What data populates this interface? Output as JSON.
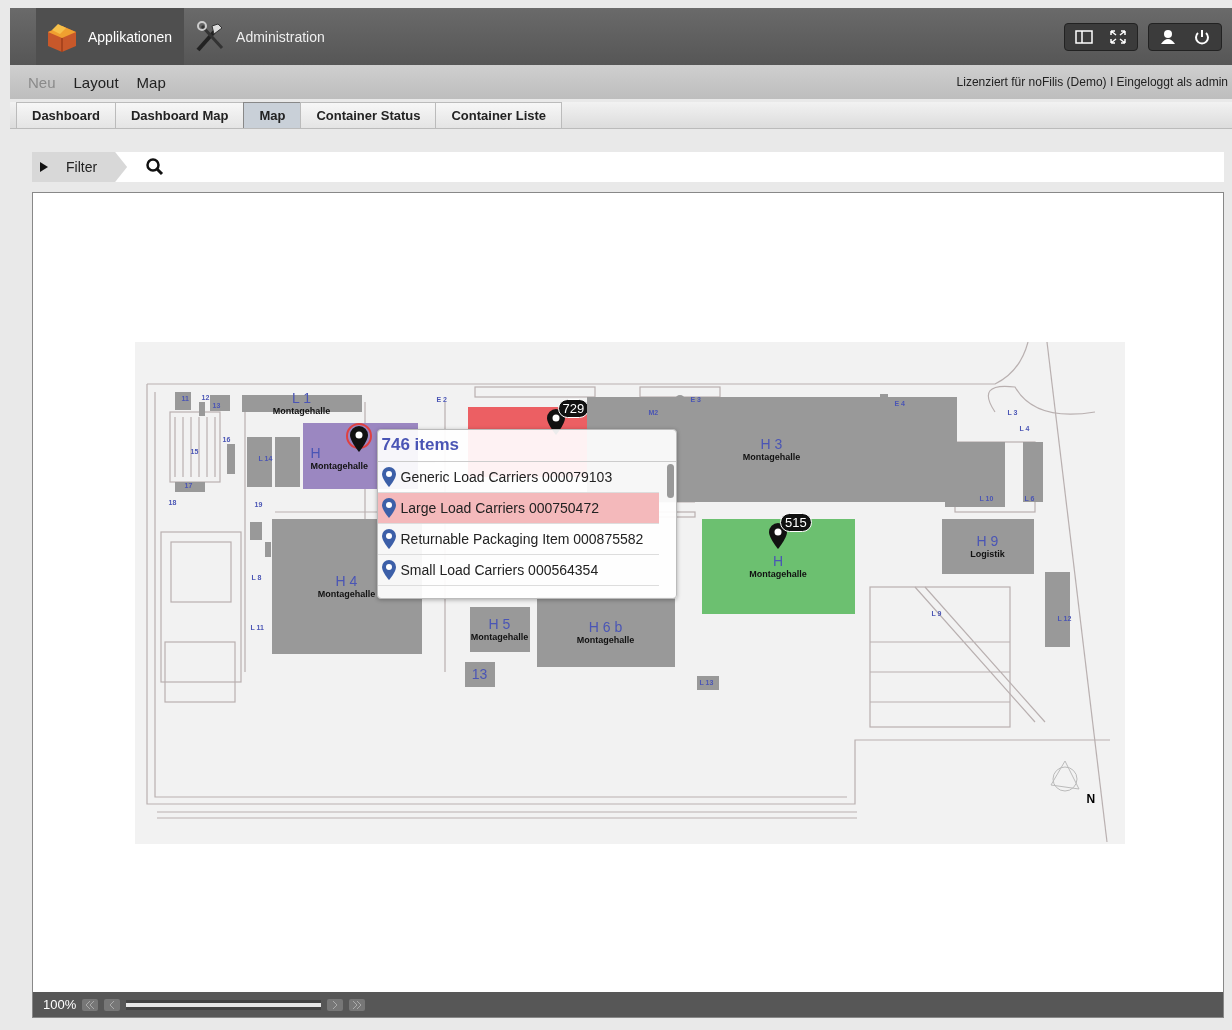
{
  "top_bar": {
    "apps": [
      {
        "label": "Applikationen",
        "selected": true
      },
      {
        "label": "Administration",
        "selected": false
      }
    ]
  },
  "menu": {
    "items": [
      {
        "label": "Neu",
        "disabled": true
      },
      {
        "label": "Layout",
        "disabled": false
      },
      {
        "label": "Map",
        "disabled": false
      }
    ],
    "status": "Lizenziert für noFilis (Demo) I Eingeloggt als admin"
  },
  "tabs": [
    {
      "label": "Dashboard",
      "selected": false
    },
    {
      "label": "Dashboard Map",
      "selected": false
    },
    {
      "label": "Map",
      "selected": true
    },
    {
      "label": "Container Status",
      "selected": false
    },
    {
      "label": "Container Liste",
      "selected": false
    }
  ],
  "filter": {
    "label": "Filter",
    "expanded": false
  },
  "map": {
    "areas": [
      {
        "kind": "building",
        "code": "L 1",
        "name": "Montagehalle"
      },
      {
        "kind": "zone",
        "color": "#9b87c1",
        "code": "H",
        "name": "Montagehalle",
        "pin": {
          "ring": true
        }
      },
      {
        "kind": "zone",
        "color": "#ec5f63",
        "pin": {
          "count": "729"
        }
      },
      {
        "kind": "building",
        "code": "H 3",
        "name": "Montagehalle"
      },
      {
        "kind": "building",
        "code": "H 4",
        "name": "Montagehalle"
      },
      {
        "kind": "building",
        "code": "H 5",
        "name": "Montagehalle"
      },
      {
        "kind": "building",
        "code": "H 6 b",
        "name": "Montagehalle"
      },
      {
        "kind": "zone",
        "color": "#6cc070",
        "code": "H",
        "name": "Montagehalle",
        "pin": {
          "count": "515"
        }
      },
      {
        "kind": "building",
        "code": "H 9",
        "name": "Logistik"
      },
      {
        "kind": "building",
        "code": "13"
      }
    ],
    "labels": [
      "11",
      "12",
      "13",
      "E 2",
      "M2",
      "E 3",
      "E 4",
      "L 3",
      "L 4",
      "L 10",
      "L 6",
      "L 9",
      "L 12",
      "L 14",
      "15",
      "16",
      "17",
      "18",
      "19",
      "L 8",
      "L 11",
      "L 13"
    ],
    "compass": "N",
    "popup": {
      "title": "746 items",
      "items": [
        {
          "label": "Generic Load Carriers 000079103",
          "selected": false
        },
        {
          "label": "Large Load Carriers 000750472",
          "selected": true
        },
        {
          "label": "Returnable Packaging Item 000875582",
          "selected": false
        },
        {
          "label": "Small Load Carriers 000564354",
          "selected": false
        }
      ]
    }
  },
  "zoom": {
    "reading": "100%",
    "level": 1
  }
}
